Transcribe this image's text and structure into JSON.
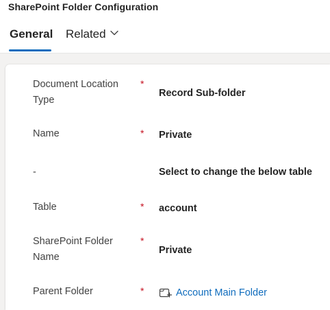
{
  "header": {
    "title": "SharePoint Folder Configuration"
  },
  "tabs": [
    {
      "label": "General",
      "selected": true
    },
    {
      "label": "Related",
      "selected": false
    }
  ],
  "icons": {
    "related_chevron": "chevron-down-icon",
    "lookup": "record-lookup-icon"
  },
  "colors": {
    "accent": "#0f6cbd",
    "required": "#c50f1f",
    "backdrop": "#f3f2f1"
  },
  "fields": [
    {
      "label": "Document Location Type",
      "required": "*",
      "value": "Record Sub-folder"
    },
    {
      "label": "Name",
      "required": "*",
      "value": "Private"
    },
    {
      "label": "-",
      "required": "",
      "value": "Select to change the below table"
    },
    {
      "label": "Table",
      "required": "*",
      "value": "account"
    },
    {
      "label": "SharePoint Folder Name",
      "required": "*",
      "value": "Private"
    },
    {
      "label": "Parent Folder",
      "required": "*",
      "value": "Account Main Folder"
    }
  ]
}
